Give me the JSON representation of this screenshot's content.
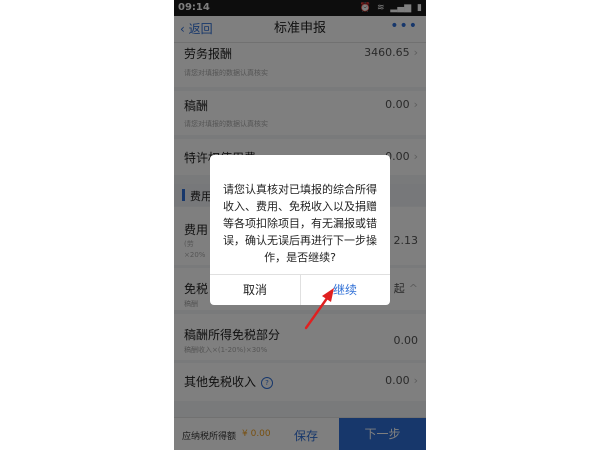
{
  "status_bar": {
    "time": "09:14",
    "icons": [
      "⏰",
      "≋",
      "▂▄▆",
      "▮"
    ]
  },
  "nav": {
    "back_label": "‹ 返回",
    "title": "标准申报",
    "more_label": "•••"
  },
  "rows": [
    {
      "label": "劳务报酬",
      "value": "3460.65",
      "hint": "请您对填报的数据认真核实"
    },
    {
      "label": "稿酬",
      "value": "0.00",
      "hint": "请您对填报的数据认真核实"
    },
    {
      "label": "特许权使用费",
      "value": "0.00",
      "hint": ""
    }
  ],
  "section": {
    "label": "费用"
  },
  "partial_rows": [
    {
      "label": "费用",
      "value": "2.13",
      "hint": "(劳",
      "hint2": "×20%"
    },
    {
      "label": "免税",
      "value": "起",
      "hint": "稿酬"
    }
  ],
  "lower_rows": [
    {
      "label": "稿酬所得免税部分",
      "value": "0.00",
      "hint": "稿酬收入×(1-20%)×30%"
    },
    {
      "label": "其他免税收入",
      "value": "0.00",
      "info": "?"
    }
  ],
  "bottom": {
    "due_label": "应纳税所得额",
    "due_value": "¥ 0.00",
    "save_label": "保存",
    "next_label": "下一步"
  },
  "dialog": {
    "message": "请您认真核对已填报的综合所得收入、费用、免税收入以及捐赠等各项扣除项目，有无漏报或错误，确认无误后再进行下一步操作，是否继续?",
    "cancel_label": "取消",
    "confirm_label": "继续"
  },
  "colors": {
    "accent": "#2f6fd6",
    "annotation": "#e02020",
    "due": "#f0a020"
  }
}
